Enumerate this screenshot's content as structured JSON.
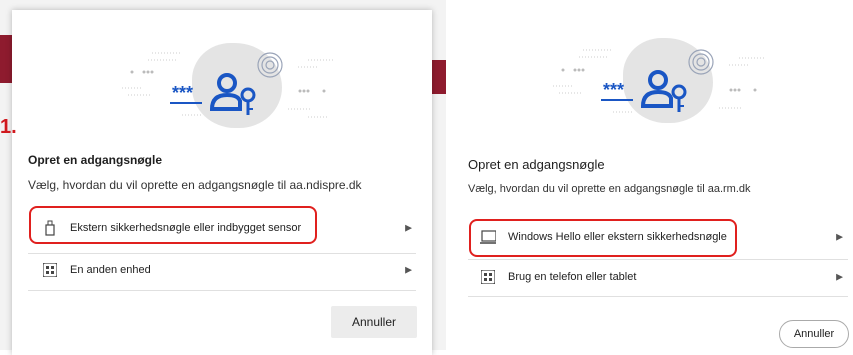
{
  "step_marker": "1.",
  "left_dialog": {
    "title": "Opret en adgangsnøgle",
    "subtitle": "Vælg, hvordan du vil oprette en adgangsnøgle til aa.ndispre.dk",
    "options": [
      {
        "label": "Ekstern sikkerhedsnøgle eller indbygget sensor",
        "icon": "usb-key-icon"
      },
      {
        "label": "En anden enhed",
        "icon": "qr-code-icon"
      }
    ],
    "cancel_label": "Annuller"
  },
  "right_dialog": {
    "title": "Opret en adgangsnøgle",
    "subtitle": "Vælg, hvordan du vil oprette en adgangsnøgle til aa.rm.dk",
    "options": [
      {
        "label": "Windows Hello eller ekstern sikkerhedsnøgle",
        "icon": "laptop-icon"
      },
      {
        "label": "Brug en telefon eller tablet",
        "icon": "qr-code-icon"
      }
    ],
    "cancel_label": "Annuller"
  },
  "colors": {
    "accent_blue": "#1a56c4",
    "highlight_red": "#e0201e",
    "background_strip": "#8e1b2e"
  }
}
